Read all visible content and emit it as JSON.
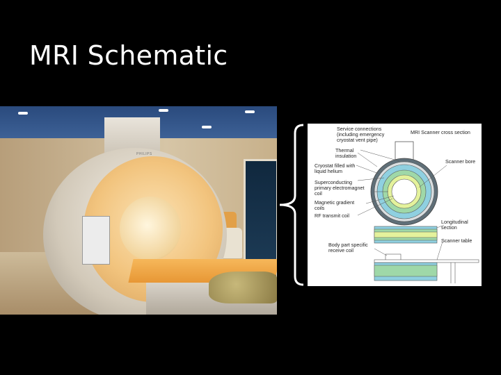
{
  "slide": {
    "title": "MRI Schematic"
  },
  "photo": {
    "machine_label": "PHILIPS"
  },
  "schematic": {
    "caption": "MRI Scanner cross section",
    "labels": {
      "service": "Service connections\n(including emergency\ncryostat vent pipe)",
      "thermal": "Thermal\ninsulation",
      "cryostat": "Cryostat filled with\nliquid helium",
      "superconducting": "Superconducting\nprimary electromagnet\ncoil",
      "gradient": "Magnetic gradient\ncoils",
      "rf": "RF transmit coil",
      "bore": "Scanner bore",
      "longitudinal": "Longitudinal\nsection",
      "table": "Scanner table",
      "body_coil": "Body part specific\nreceive coil"
    },
    "colors": {
      "outer_ring": "#5f6f78",
      "cryostat": "#8fd0e0",
      "coil": "#9fd8a8",
      "gradient": "#e4f29c",
      "bore": "#ffffff"
    }
  }
}
